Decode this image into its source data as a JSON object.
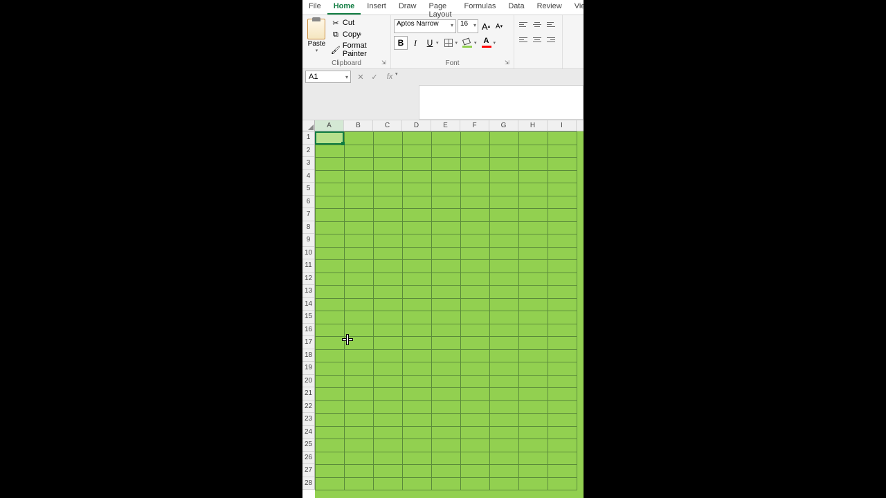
{
  "ribbon": {
    "tabs": [
      "File",
      "Home",
      "Insert",
      "Draw",
      "Page Layout",
      "Formulas",
      "Data",
      "Review",
      "View"
    ],
    "active_tab": "Home"
  },
  "clipboard": {
    "group_label": "Clipboard",
    "paste_label": "Paste",
    "cut_label": "Cut",
    "copy_label": "Copy",
    "format_painter_label": "Format Painter"
  },
  "font": {
    "group_label": "Font",
    "family": "Aptos Narrow",
    "size": "16",
    "grow_label": "A",
    "shrink_label": "A",
    "bold_label": "B",
    "italic_label": "I",
    "underline_label": "U"
  },
  "name_box": {
    "value": "A1"
  },
  "fx_label": "fx",
  "columns": [
    "A",
    "B",
    "C",
    "D",
    "E",
    "F",
    "G",
    "H",
    "I"
  ],
  "rows": [
    "1",
    "2",
    "3",
    "4",
    "5",
    "6",
    "7",
    "8",
    "9",
    "10",
    "11",
    "12",
    "13",
    "14",
    "15",
    "16",
    "17",
    "18",
    "19",
    "20",
    "21",
    "22",
    "23",
    "24",
    "25",
    "26",
    "27",
    "28"
  ],
  "active_col": "A",
  "grid_fill_color": "#92d050",
  "font_accent_color": "#ff0000"
}
